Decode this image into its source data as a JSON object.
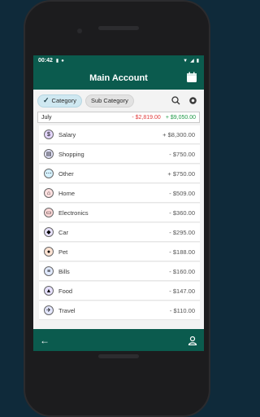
{
  "status_bar": {
    "time": "00:42"
  },
  "app_bar": {
    "title": "Main Account"
  },
  "filters": {
    "category_label": "Category",
    "sub_category_label": "Sub Category"
  },
  "summary": {
    "month": "July",
    "expense": "- $2,819.00",
    "income": "+ $9,050.00"
  },
  "categories": [
    {
      "name": "Salary",
      "amount": "+ $8,300.00",
      "icon": "salary-icon",
      "icon_bg": "#e5d7ff"
    },
    {
      "name": "Shopping",
      "amount": "- $750.00",
      "icon": "shopping-icon",
      "icon_bg": "#e7e7ff"
    },
    {
      "name": "Other",
      "amount": "+ $750.00",
      "icon": "other-icon",
      "icon_bg": "#d5f1ff"
    },
    {
      "name": "Home",
      "amount": "- $509.00",
      "icon": "home-icon",
      "icon_bg": "#ffe0e0"
    },
    {
      "name": "Electronics",
      "amount": "- $360.00",
      "icon": "electronics-icon",
      "icon_bg": "#ffdada"
    },
    {
      "name": "Car",
      "amount": "- $295.00",
      "icon": "car-icon",
      "icon_bg": "#e9e3ff"
    },
    {
      "name": "Pet",
      "amount": "- $188.00",
      "icon": "pet-icon",
      "icon_bg": "#ffe3d3"
    },
    {
      "name": "Bills",
      "amount": "- $160.00",
      "icon": "bills-icon",
      "icon_bg": "#e0e9ff"
    },
    {
      "name": "Food",
      "amount": "- $147.00",
      "icon": "food-icon",
      "icon_bg": "#e6e0ff"
    },
    {
      "name": "Travel",
      "amount": "- $110.00",
      "icon": "travel-icon",
      "icon_bg": "#e4e7ff"
    }
  ],
  "colors": {
    "primary": "#0b5b4e",
    "negative": "#e23b3b",
    "positive": "#1f9a47",
    "chip_selected": "#cfe8f1"
  }
}
